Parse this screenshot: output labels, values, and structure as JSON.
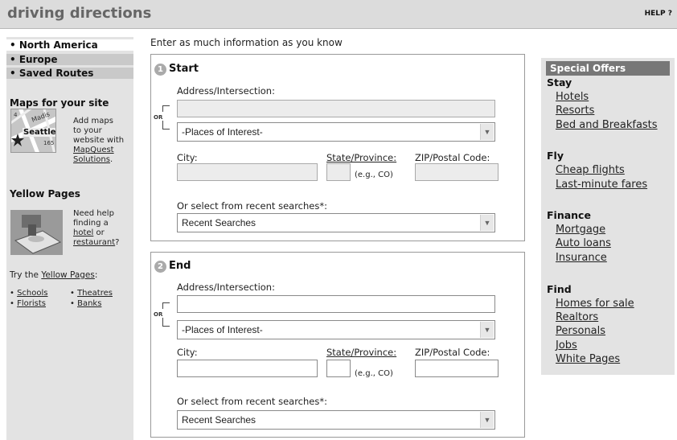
{
  "header": {
    "title": "driving directions",
    "help": "HELP ?"
  },
  "nav": {
    "items": [
      "• North America",
      "• Europe",
      "• Saved Routes"
    ]
  },
  "maps": {
    "heading": "Maps for your site",
    "lines": [
      "Add maps",
      "to your",
      "website with"
    ],
    "link_line1": "MapQuest",
    "link_line2": "Solutions",
    "after": ".",
    "map_labels": {
      "street": "Madis",
      "city": "Seattle",
      "route": "165",
      "num": "4"
    }
  },
  "yellow": {
    "heading": "Yellow Pages",
    "line1": "Need help",
    "line2": "finding a",
    "hotel": "hotel",
    "or_text": " or",
    "restaurant": "restaurant",
    "q": "?",
    "try_prefix": "Try the ",
    "try_link": "Yellow Pages",
    "try_suffix": ":",
    "links": [
      "Schools",
      "Theatres",
      "Florists",
      "Banks"
    ]
  },
  "form": {
    "intro": "Enter as much information as you know",
    "or": "OR",
    "start": {
      "num": "1",
      "title": "Start",
      "address_label": "Address/Intersection:",
      "poi": "-Places of Interest-",
      "city": "City:",
      "state": "State/Province:",
      "eg": "(e.g., CO)",
      "zip": "ZIP/Postal Code:",
      "recent_label": "Or select from recent searches*:",
      "recent": "Recent Searches"
    },
    "end": {
      "num": "2",
      "title": "End",
      "address_label": "Address/Intersection:",
      "poi": "-Places of Interest-",
      "city": "City:",
      "state": "State/Province:",
      "eg": "(e.g., CO)",
      "zip": "ZIP/Postal Code:",
      "recent_label": "Or select from recent searches*:",
      "recent": "Recent Searches"
    }
  },
  "offers": {
    "header": "Special Offers",
    "stay": {
      "title": "Stay",
      "links": [
        "Hotels",
        "Resorts",
        "Bed and Breakfasts"
      ]
    },
    "fly": {
      "title": "Fly",
      "links": [
        "Cheap flights",
        "Last-minute fares"
      ]
    },
    "finance": {
      "title": "Finance",
      "links": [
        "Mortgage",
        "Auto loans",
        "Insurance"
      ]
    },
    "find": {
      "title": "Find",
      "links": [
        "Homes for sale",
        "Realtors",
        "Personals",
        "Jobs",
        "White Pages"
      ]
    }
  },
  "colors": {
    "header_bg": "#dcdcdc",
    "sidebar_bg": "#e3e3e3",
    "offer_header_bg": "#777777"
  },
  "icons": [
    "down-arrow-icon",
    "map-thumbnail",
    "yellow-pages-thumbnail"
  ]
}
